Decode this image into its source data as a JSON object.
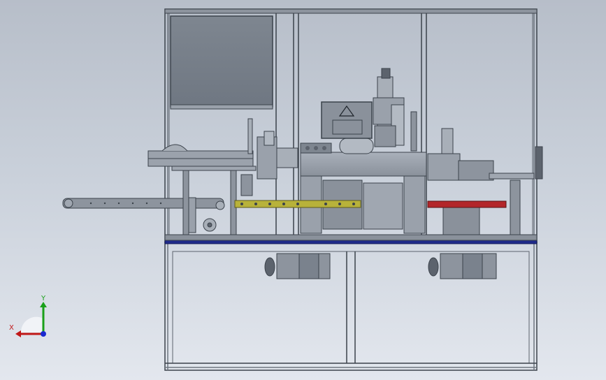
{
  "viewport": {
    "background": {
      "top": "#b7bec9",
      "bottom": "#e3e7ee"
    },
    "model": {
      "frame_color": "#6e7680",
      "panel_color": "#7a828d",
      "base_rail_color": "#1f2a8a",
      "yellow_conveyor_color": "#b8b23a",
      "red_conveyor_color": "#b3262a",
      "machine_color": "#9aa1ab",
      "warning_symbol": "triangle-warning-icon"
    }
  },
  "triad": {
    "y_label": "Y",
    "x_label": "X",
    "y_color": "#1aa01a",
    "x_color": "#c01818",
    "z_color": "#1a2ad0"
  }
}
